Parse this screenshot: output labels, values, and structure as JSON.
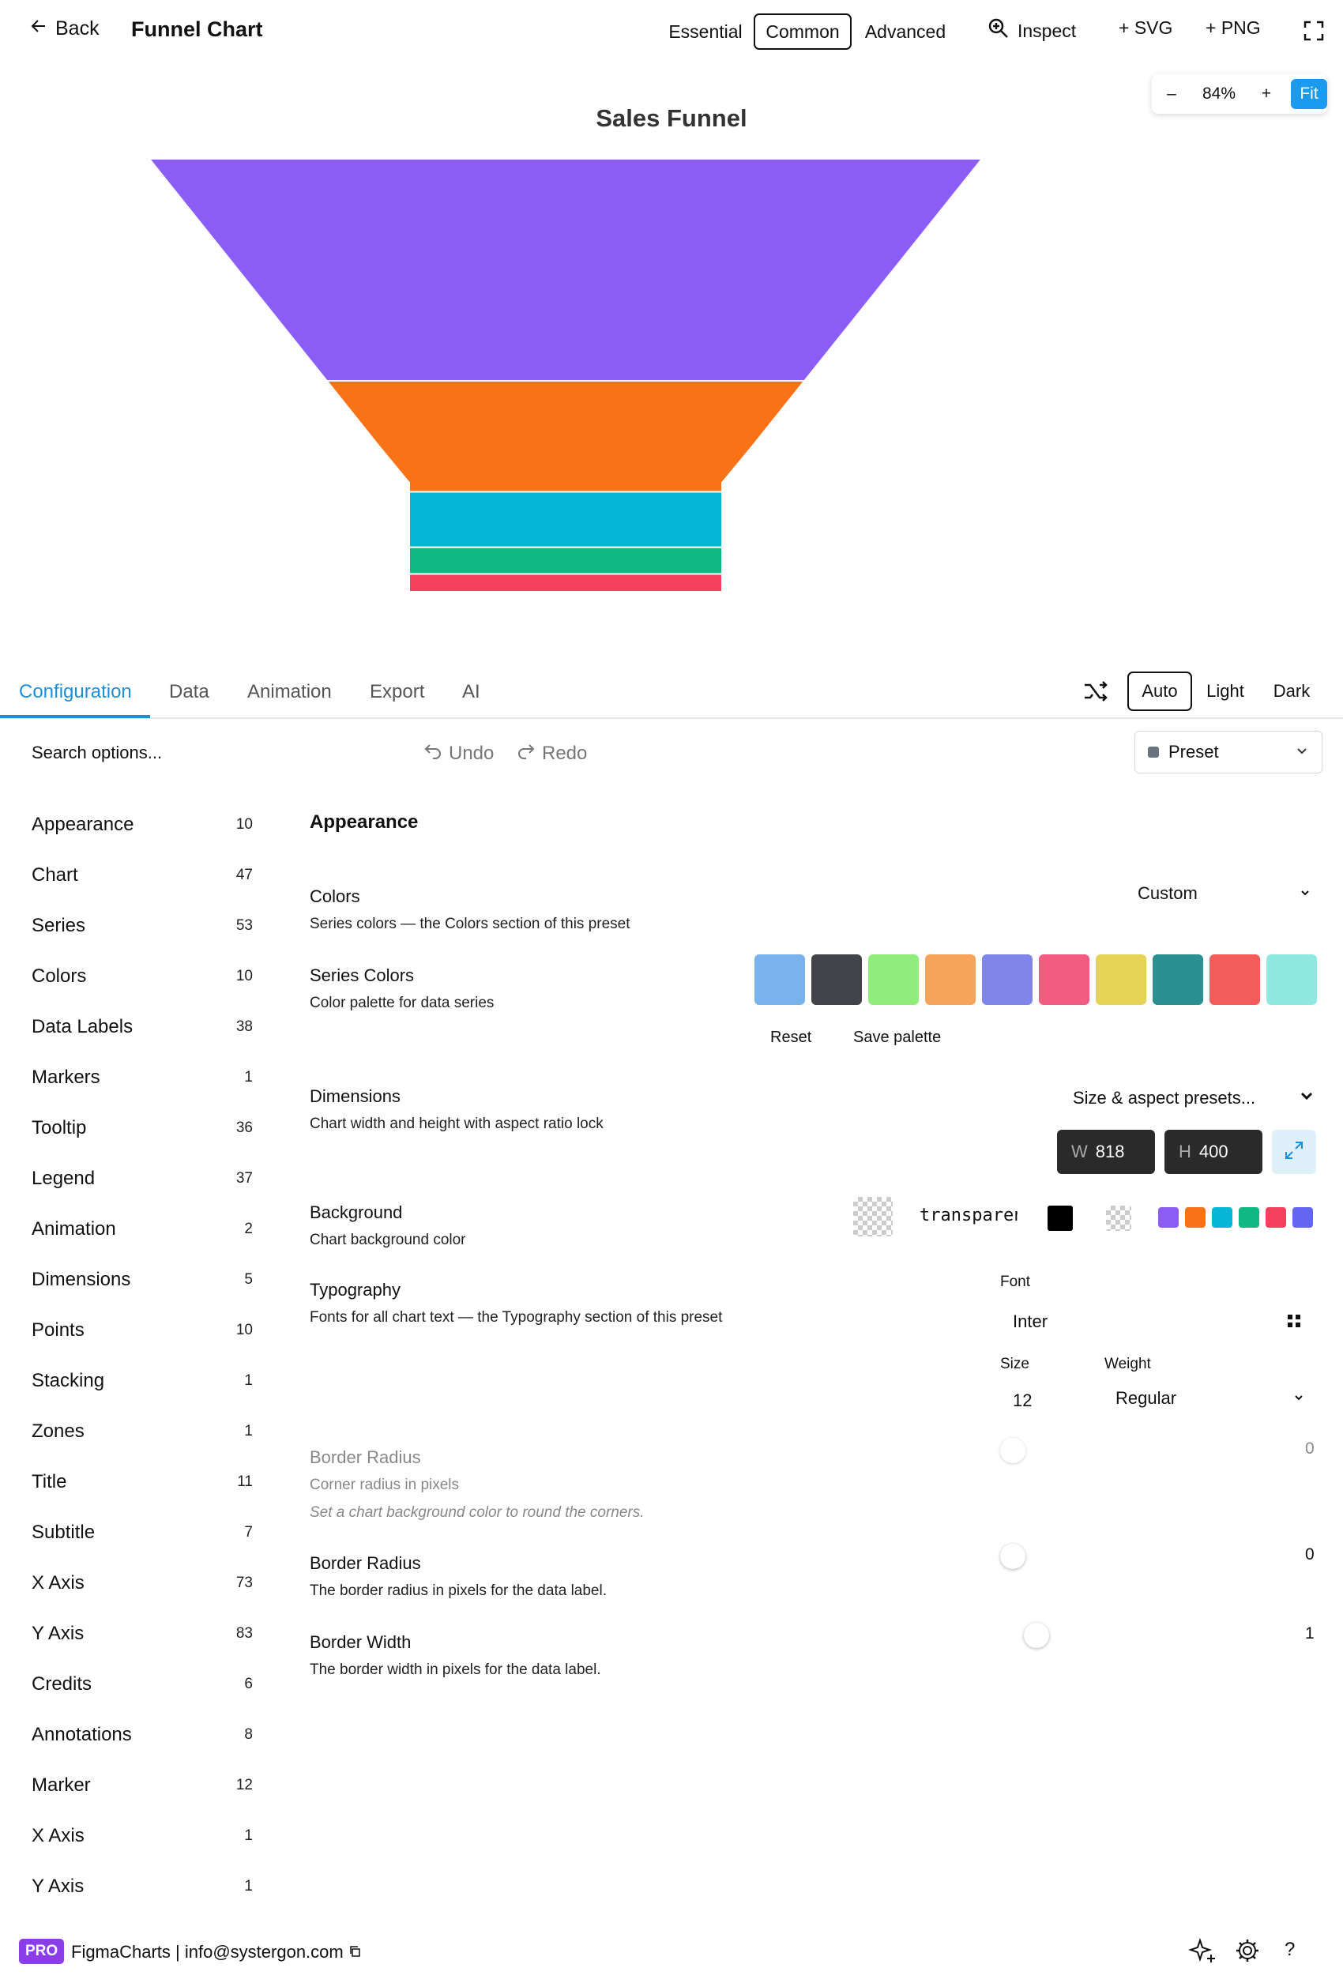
{
  "header": {
    "back_label": "Back",
    "title": "Funnel Chart",
    "modes": [
      "Essential",
      "Common",
      "Advanced"
    ],
    "inspect_label": "Inspect",
    "svg_label": "+ SVG",
    "png_label": "+ PNG"
  },
  "zoom": {
    "minus": "–",
    "value": "84%",
    "plus": "+",
    "fit": "Fit"
  },
  "chart_data": {
    "type": "funnel",
    "title": "Sales Funnel",
    "stages": [
      {
        "color": "#8b5cf6",
        "value": 1000
      },
      {
        "color": "#f97316",
        "value": 500
      },
      {
        "color": "#06b6d4",
        "value": 250
      },
      {
        "color": "#10b981",
        "value": 120
      },
      {
        "color": "#f43f5e",
        "value": 80
      }
    ]
  },
  "tabs": [
    "Configuration",
    "Data",
    "Animation",
    "Export",
    "AI"
  ],
  "theme": {
    "auto": "Auto",
    "light": "Light",
    "dark": "Dark"
  },
  "toolbar": {
    "search_placeholder": "Search options...",
    "undo": "Undo",
    "redo": "Redo",
    "preset": "Preset"
  },
  "sidebar": [
    {
      "label": "Appearance",
      "count": "10"
    },
    {
      "label": "Chart",
      "count": "47"
    },
    {
      "label": "Series",
      "count": "53"
    },
    {
      "label": "Colors",
      "count": "10"
    },
    {
      "label": "Data Labels",
      "count": "38"
    },
    {
      "label": "Markers",
      "count": "1"
    },
    {
      "label": "Tooltip",
      "count": "36"
    },
    {
      "label": "Legend",
      "count": "37"
    },
    {
      "label": "Animation",
      "count": "2"
    },
    {
      "label": "Dimensions",
      "count": "5"
    },
    {
      "label": "Points",
      "count": "10"
    },
    {
      "label": "Stacking",
      "count": "1"
    },
    {
      "label": "Zones",
      "count": "1"
    },
    {
      "label": "Title",
      "count": "11"
    },
    {
      "label": "Subtitle",
      "count": "7"
    },
    {
      "label": "X Axis",
      "count": "73"
    },
    {
      "label": "Y Axis",
      "count": "83"
    },
    {
      "label": "Credits",
      "count": "6"
    },
    {
      "label": "Annotations",
      "count": "8"
    },
    {
      "label": "Marker",
      "count": "12"
    },
    {
      "label": "X Axis",
      "count": "1"
    },
    {
      "label": "Y Axis",
      "count": "1"
    }
  ],
  "settings": {
    "section_title": "Appearance",
    "colors": {
      "label": "Colors",
      "desc": "Series colors — the Colors section of this preset",
      "value": "Custom"
    },
    "series_colors": {
      "label": "Series Colors",
      "desc": "Color palette for data series",
      "palette": [
        "#7ab3ec",
        "#43434a",
        "#90ed7d",
        "#f7a35c",
        "#8085e9",
        "#f15c80",
        "#e4d354",
        "#2b908f",
        "#f45b5b",
        "#91e8e1"
      ],
      "reset": "Reset",
      "save": "Save palette"
    },
    "dimensions": {
      "label": "Dimensions",
      "desc": "Chart width and height with aspect ratio lock",
      "presets": "Size & aspect presets...",
      "w_key": "W",
      "w": "818",
      "h_key": "H",
      "h": "400"
    },
    "background": {
      "label": "Background",
      "desc": "Chart background color",
      "value": "transparent",
      "quick": [
        "#8b5cf6",
        "#f97316",
        "#06b6d4",
        "#10b981",
        "#f43f5e",
        "#6366f1"
      ]
    },
    "typography": {
      "label": "Typography",
      "desc": "Fonts for all chart text — the Typography section of this preset",
      "font_label": "Font",
      "font": "Inter",
      "size_label": "Size",
      "size": "12",
      "weight_label": "Weight",
      "weight": "Regular"
    },
    "border_radius_disabled": {
      "label": "Border Radius",
      "desc": "Corner radius in pixels",
      "note": "Set a chart background color to round the corners.",
      "value": "0"
    },
    "border_radius": {
      "label": "Border Radius",
      "desc": "The border radius in pixels for the data label.",
      "value": "0"
    },
    "border_width": {
      "label": "Border Width",
      "desc": "The border width in pixels for the data label.",
      "value": "1"
    }
  },
  "footer": {
    "badge": "PRO",
    "brand": "FigmaCharts",
    "email": "info@systergon.com"
  }
}
